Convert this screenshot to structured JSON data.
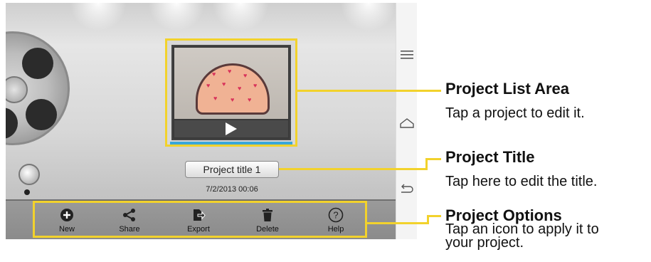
{
  "project": {
    "title": "Project title 1",
    "date": "7/2/2013 00:06"
  },
  "options": [
    {
      "label": "New",
      "icon": "plus-circle-icon"
    },
    {
      "label": "Share",
      "icon": "share-icon"
    },
    {
      "label": "Export",
      "icon": "export-icon"
    },
    {
      "label": "Delete",
      "icon": "trash-icon"
    },
    {
      "label": "Help",
      "icon": "help-icon"
    }
  ],
  "nav": {
    "icons": [
      "menu-icon",
      "home-icon",
      "back-icon"
    ]
  },
  "callouts": {
    "list_area_title": "Project List Area",
    "list_area_text": "Tap a project to edit it.",
    "title_title": "Project Title",
    "title_text": "Tap here to edit the title.",
    "options_title": "Project Options",
    "options_text_line1": "Tap an icon to apply it to",
    "options_text_line2": "your project."
  },
  "colors": {
    "callout_accent": "#f2d22c",
    "shelf_blue": "#3aa6d8"
  }
}
